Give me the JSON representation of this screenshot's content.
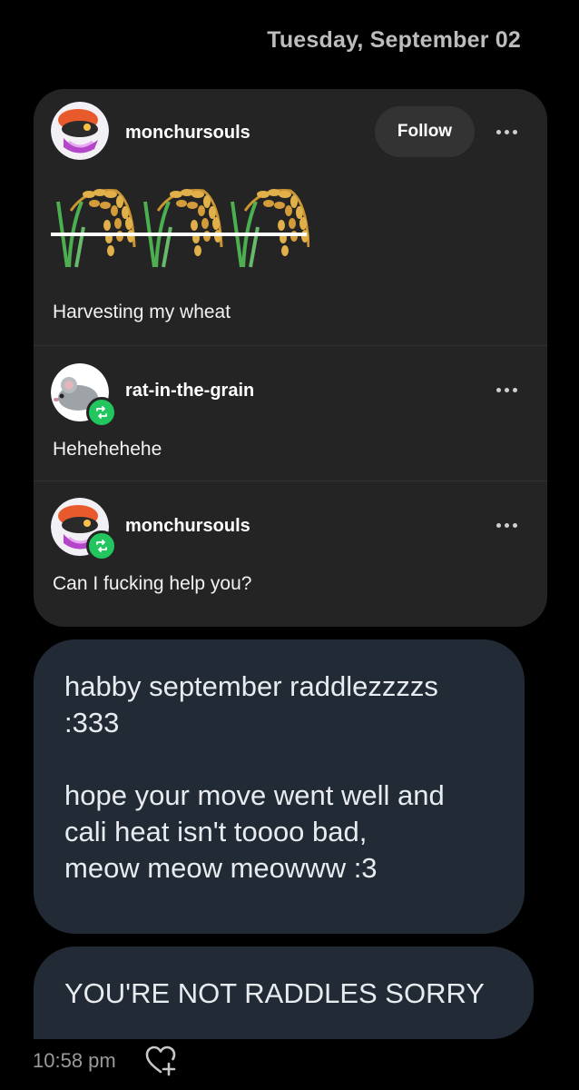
{
  "date_header": "Tuesday, September 02",
  "post": {
    "original": {
      "username": "monchursouls",
      "follow_label": "Follow",
      "body": "Harvesting my wheat",
      "image_icon": "wheat-sheaf-icon"
    },
    "reblogs": [
      {
        "username": "rat-in-the-grain",
        "body": "Hehehehehe",
        "badge_icon": "reblog-icon"
      },
      {
        "username": "monchursouls",
        "body": "Can I fucking help you?",
        "badge_icon": "reblog-icon"
      }
    ]
  },
  "messages": {
    "bubble1": {
      "line1": "habby september raddlezzzzs",
      "line2": ":333",
      "line3": "hope your move went well and",
      "line4": "cali heat isn't toooo bad,",
      "line5": "meow meow meowww :3"
    },
    "bubble2": {
      "text": "YOU'RE NOT RADDLES SORRY"
    }
  },
  "footer": {
    "timestamp": "10:58 pm",
    "react_icon": "heart-plus-icon"
  },
  "colors": {
    "background": "#000000",
    "card": "#242424",
    "bubble": "#222b35",
    "reblog_badge": "#22c55e"
  }
}
